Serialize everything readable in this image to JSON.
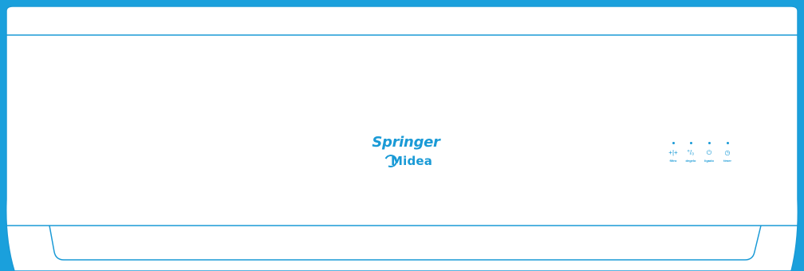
{
  "brand": {
    "primary": "Springer",
    "secondary": "Midea",
    "color": "#1a9ad6"
  },
  "indicators": [
    {
      "label": "filtro",
      "icon": "filter-icon",
      "symbol": "+|+"
    },
    {
      "label": "degelo",
      "icon": "defrost-icon",
      "symbol": "°/₀"
    },
    {
      "label": "ligado",
      "icon": "power-icon",
      "symbol": "⏻"
    },
    {
      "label": "timer",
      "icon": "timer-icon",
      "symbol": "◷"
    }
  ],
  "colors": {
    "background": "#1aa0dc",
    "unit_body": "#ffffff",
    "outline": "#1a9ad6"
  }
}
